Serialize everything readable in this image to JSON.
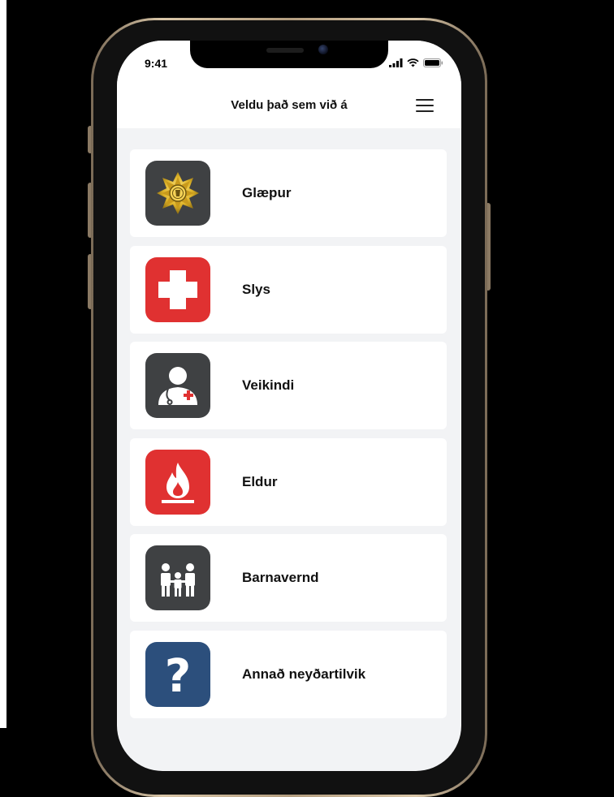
{
  "status_bar": {
    "time": "9:41"
  },
  "header": {
    "title": "Veldu það sem við á"
  },
  "items": [
    {
      "label": "Glæpur",
      "icon": "police-badge-icon",
      "tile_color": "#3f4143"
    },
    {
      "label": "Slys",
      "icon": "first-aid-cross-icon",
      "tile_color": "#e03131"
    },
    {
      "label": "Veikindi",
      "icon": "doctor-icon",
      "tile_color": "#3f4143"
    },
    {
      "label": "Eldur",
      "icon": "fire-icon",
      "tile_color": "#e03131"
    },
    {
      "label": "Barnavernd",
      "icon": "family-icon",
      "tile_color": "#3f4143"
    },
    {
      "label": "Annað neyðartilvik",
      "icon": "question-mark-icon",
      "tile_color": "#2c4f7c"
    }
  ]
}
